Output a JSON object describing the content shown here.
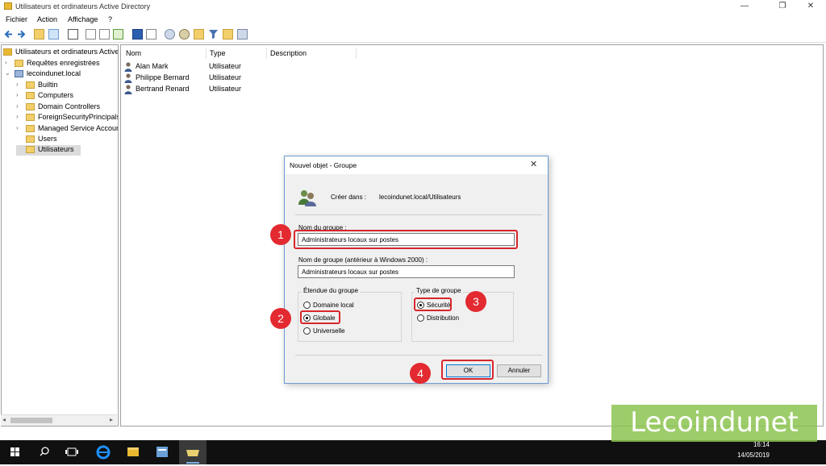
{
  "window": {
    "title": "Utilisateurs et ordinateurs Active Directory",
    "minimize": "—",
    "restore": "❐",
    "close": "✕"
  },
  "menu": [
    "Fichier",
    "Action",
    "Affichage",
    "?"
  ],
  "tree": {
    "root": "Utilisateurs et ordinateurs Active",
    "saved_queries": "Requêtes enregistrées",
    "domain": "lecoindunet.local",
    "children": [
      "Builtin",
      "Computers",
      "Domain Controllers",
      "ForeignSecurityPrincipals",
      "Managed Service Accoun",
      "Users",
      "Utilisateurs"
    ]
  },
  "list": {
    "columns": [
      "Nom",
      "Type",
      "Description"
    ],
    "rows": [
      {
        "name": "Alan Mark",
        "type": "Utilisateur",
        "description": ""
      },
      {
        "name": "Philippe Bernard",
        "type": "Utilisateur",
        "description": ""
      },
      {
        "name": "Bertrand Renard",
        "type": "Utilisateur",
        "description": ""
      }
    ]
  },
  "dialog": {
    "title": "Nouvel objet - Groupe",
    "close": "✕",
    "create_in_label": "Créer dans :",
    "create_in_value": "lecoindunet.local/Utilisateurs",
    "group_name_label": "Nom du groupe :",
    "group_name_value": "Administrateurs locaux sur postes",
    "pre2000_label": "Nom de groupe (antérieur à Windows 2000) :",
    "pre2000_value": "Administrateurs locaux sur postes",
    "scope": {
      "label": "Étendue du groupe",
      "options": [
        "Domaine local",
        "Globale",
        "Universelle"
      ],
      "selected": "Globale"
    },
    "type": {
      "label": "Type de groupe",
      "options": [
        "Sécurité",
        "Distribution"
      ],
      "selected": "Sécurité"
    },
    "ok": "OK",
    "cancel": "Annuler"
  },
  "callouts": [
    "1",
    "2",
    "3",
    "4"
  ],
  "watermark": "Lecoindunet",
  "taskbar": {
    "time": "16:14",
    "date": "14/05/2019"
  },
  "colors": {
    "callout_red": "#e22a30",
    "watermark_green": "#8cc450",
    "taskbar": "#101010"
  }
}
